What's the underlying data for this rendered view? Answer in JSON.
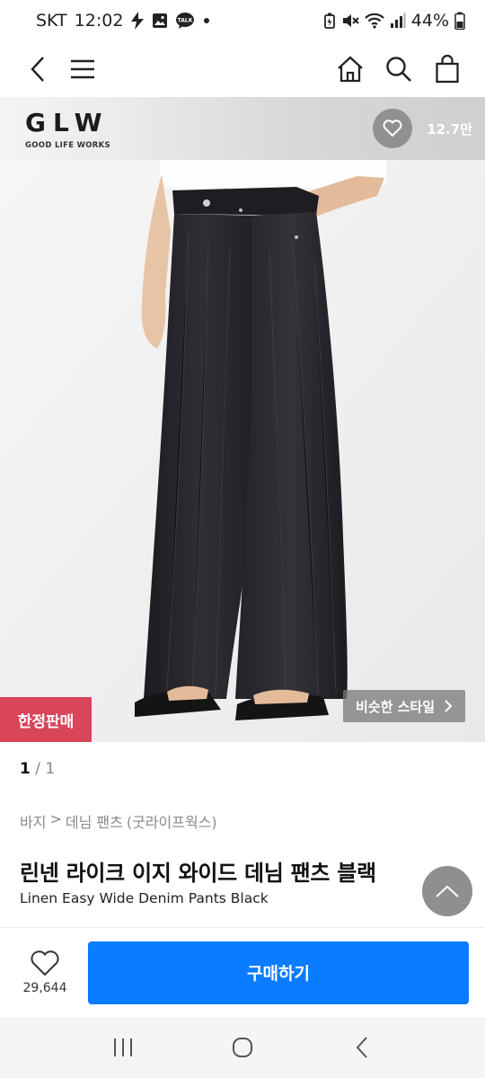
{
  "status_bar": {
    "carrier": "SKT",
    "time": "12:02",
    "battery": "44%",
    "left_icons": [
      "flash-icon",
      "gallery-icon",
      "talk-icon",
      "dot-icon"
    ],
    "right_icons": [
      "battery-saver-icon",
      "mute-icon",
      "wifi-icon",
      "signal-icon",
      "battery-icon"
    ],
    "talk_badge": "TALK"
  },
  "top_nav": {
    "icons": [
      "back-icon",
      "menu-icon",
      "home-icon",
      "search-icon",
      "cart-icon"
    ]
  },
  "brand": {
    "name": "GLW",
    "subtitle": "GOOD LIFE WORKS",
    "like_count": "12.7만"
  },
  "product_image": {
    "badge": "한정판매",
    "similar_style": "비슷한 스타일"
  },
  "pager": {
    "current": "1",
    "separator": " / ",
    "total": "1"
  },
  "breadcrumb": {
    "items": [
      "바지",
      ">",
      "데님 팬츠",
      "(굿라이프웍스)"
    ]
  },
  "product": {
    "title_ko": "린넨 라이크 이지 와이드 데님 팬츠 블랙",
    "title_en": "Linen Easy Wide Denim Pants Black"
  },
  "action_bar": {
    "wish_count": "29,644",
    "buy_label": "구매하기"
  },
  "android_nav": {
    "icons": [
      "recents-icon",
      "home-circle-icon",
      "back-chevron-icon"
    ]
  },
  "colors": {
    "buy_button": "#0a7cff",
    "limited_badge": "#d9455b",
    "jeans": "#26262b"
  }
}
